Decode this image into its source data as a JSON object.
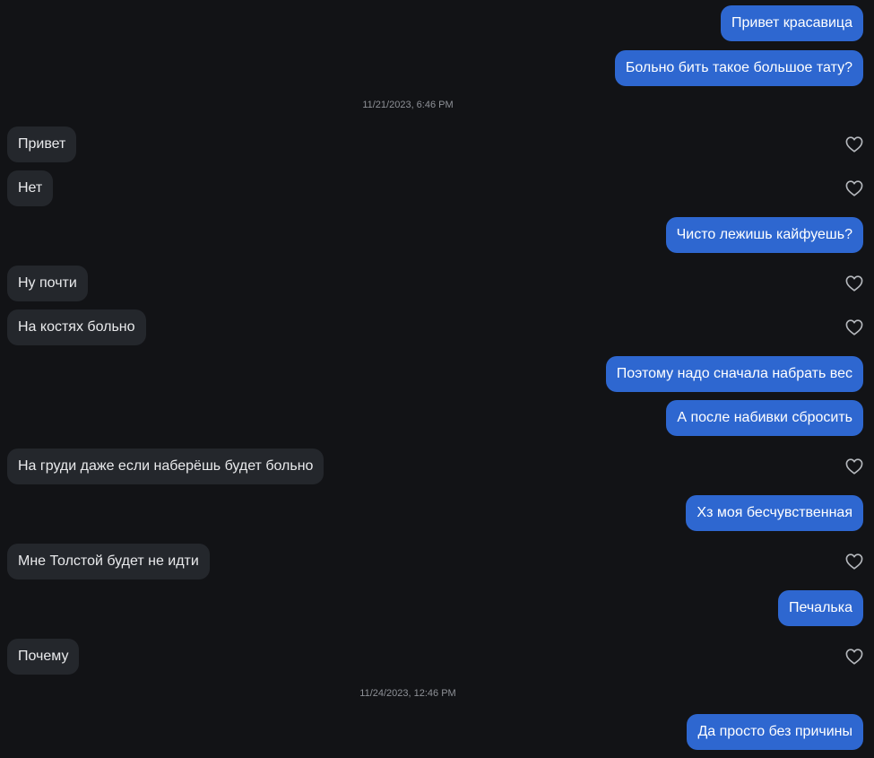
{
  "messages": [
    {
      "type": "sent",
      "text": "Привет красавица"
    },
    {
      "type": "sent",
      "text": "Больно бить такое большое тату?"
    },
    {
      "type": "timestamp",
      "text": "11/21/2023, 6:46 PM"
    },
    {
      "type": "received",
      "text": "Привет",
      "like_icon": "heart-icon"
    },
    {
      "type": "received",
      "text": "Нет",
      "like_icon": "heart-icon"
    },
    {
      "type": "sent",
      "text": "Чисто лежишь кайфуешь?"
    },
    {
      "type": "received",
      "text": "Ну почти",
      "like_icon": "heart-icon"
    },
    {
      "type": "received",
      "text": "На костях больно",
      "like_icon": "heart-icon"
    },
    {
      "type": "sent",
      "text": "Поэтому надо сначала набрать вес"
    },
    {
      "type": "sent",
      "text": "А после набивки сбросить"
    },
    {
      "type": "received",
      "text": "На груди даже если наберёшь будет больно",
      "like_icon": "heart-icon"
    },
    {
      "type": "sent",
      "text": "Хз моя бесчувственная"
    },
    {
      "type": "received",
      "text": "Мне Толстой будет не идти",
      "like_icon": "heart-icon"
    },
    {
      "type": "sent",
      "text": "Печалька"
    },
    {
      "type": "received",
      "text": "Почему",
      "like_icon": "heart-icon"
    },
    {
      "type": "timestamp",
      "text": "11/24/2023, 12:46 PM"
    },
    {
      "type": "sent",
      "text": "Да просто без причины"
    }
  ],
  "colors": {
    "background": "#121316",
    "sent_bubble": "#2e67d0",
    "received_bubble": "#24272c",
    "timestamp_text": "#8e9197",
    "heart_outline": "#b5b8bd"
  }
}
